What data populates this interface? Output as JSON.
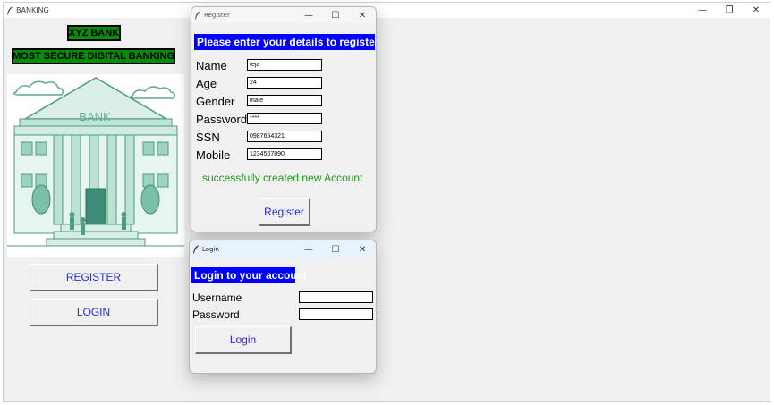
{
  "main_window": {
    "title": "BANKING",
    "controls": {
      "minimize": "—",
      "restore": "❐",
      "close": "✕"
    }
  },
  "labels": {
    "bank_name": "XYZ BANK",
    "tagline": "MOST SECURE DIGITAL BANKING",
    "bank_sign": "BANK"
  },
  "buttons": {
    "register": "REGISTER",
    "login": "LOGIN"
  },
  "register_dialog": {
    "title": "Register",
    "controls": {
      "minimize": "—",
      "maximize": "☐",
      "close": "✕"
    },
    "header": "Please enter your details to register",
    "fields": [
      {
        "label": "Name",
        "value": "teja"
      },
      {
        "label": "Age",
        "value": "24"
      },
      {
        "label": "Gender",
        "value": "male"
      },
      {
        "label": "Password",
        "value": "****"
      },
      {
        "label": "SSN",
        "value": "0987654321"
      },
      {
        "label": "Mobile",
        "value": "1234567890"
      }
    ],
    "status": "successfully created new Account",
    "submit_label": "Register"
  },
  "login_dialog": {
    "title": "Login",
    "controls": {
      "minimize": "—",
      "maximize": "☐",
      "close": "✕"
    },
    "header": "Login to your account",
    "username_label": "Username",
    "username_value": "",
    "password_label": "Password",
    "password_value": "",
    "submit_label": "Login"
  },
  "colors": {
    "green_label_bg": "#0a8a0a",
    "header_blue": "#0000ff",
    "button_text": "#2b2bd6",
    "success_green": "#1a9b1a",
    "building_teal": "#5faa93"
  },
  "icons": [
    "feather-icon",
    "minimize-icon",
    "restore-icon",
    "maximize-icon",
    "close-icon"
  ]
}
